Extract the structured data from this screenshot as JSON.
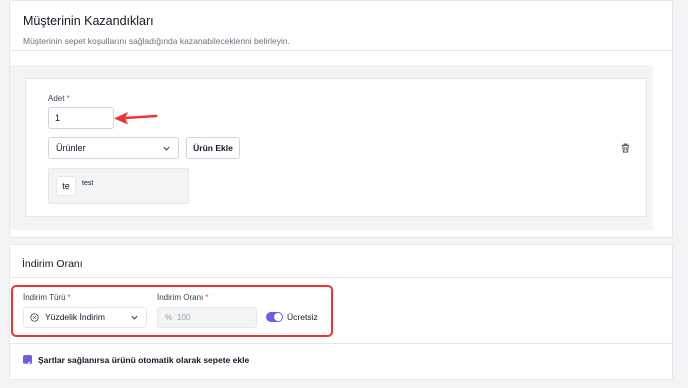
{
  "section1": {
    "title": "Müşterinin Kazandıkları",
    "subtitle": "Müşterinin sepet koşullarını sağladığında kazanabileceklerini belirleyin."
  },
  "gain": {
    "quantity_label": "Adet",
    "required_mark": "*",
    "quantity_value": "1",
    "type_select_value": "Ürünler",
    "add_button_label": "Ürün Ekle",
    "product": {
      "thumb_text": "te",
      "name": "test"
    }
  },
  "section2": {
    "title": "İndirim Oranı",
    "type_label": "İndirim Türü",
    "type_value": "Yüzdelik İndirim",
    "rate_label": "İndirim Oranı",
    "rate_prefix": "%",
    "rate_placeholder": "100",
    "free_toggle_label": "Ücretsiz",
    "free_toggle_on": true,
    "auto_add_label": "Şartlar sağlanırsa ürünü otomatik olarak sepete ekle",
    "auto_add_checked": true
  },
  "colors": {
    "accent": "#6d5ce8",
    "annotation_red": "#ef3434"
  },
  "icons": [
    "arrow-annotation-icon",
    "chevron-down-icon",
    "trash-icon",
    "percent-circle-icon",
    "check-icon"
  ]
}
